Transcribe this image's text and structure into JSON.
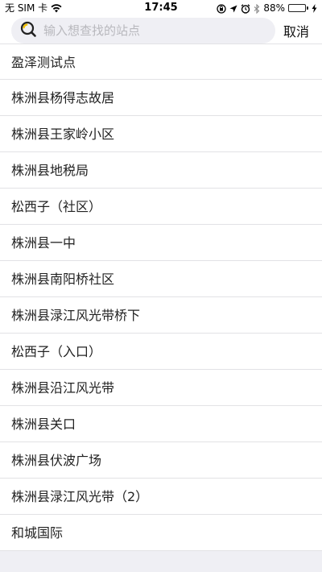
{
  "status_bar": {
    "carrier": "无 SIM 卡",
    "time": "17:45",
    "battery_percent": "88%",
    "battery_level": 0.88,
    "battery_color": "#4cd964"
  },
  "search": {
    "placeholder": "输入想查找的站点",
    "value": "",
    "icon": "search-icon",
    "cancel_label": "取消"
  },
  "stations": [
    {
      "name": "盈泽测试点"
    },
    {
      "name": "株洲县杨得志故居"
    },
    {
      "name": "株洲县王家岭小区"
    },
    {
      "name": "株洲县地税局"
    },
    {
      "name": "松西子（社区）"
    },
    {
      "name": "株洲县一中"
    },
    {
      "name": "株洲县南阳桥社区"
    },
    {
      "name": "株洲县渌江风光带桥下"
    },
    {
      "name": "松西子（入口）"
    },
    {
      "name": "株洲县沿江风光带"
    },
    {
      "name": "株洲县关口"
    },
    {
      "name": "株洲县伏波广场"
    },
    {
      "name": "株洲县渌江风光带（2）"
    },
    {
      "name": "和城国际"
    }
  ]
}
